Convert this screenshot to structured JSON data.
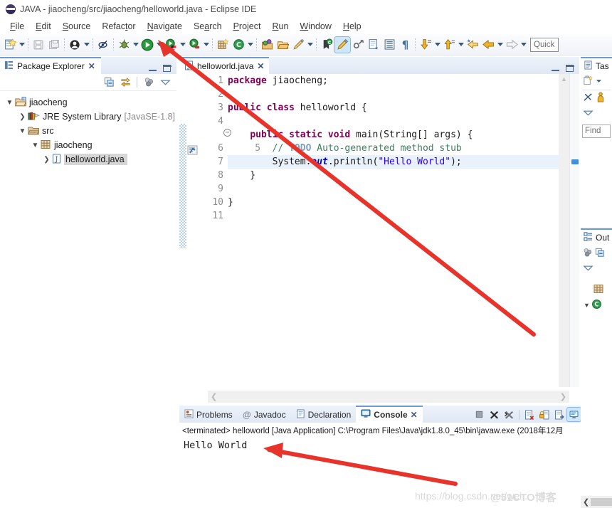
{
  "window": {
    "title": "JAVA - jiaocheng/src/jiaocheng/helloworld.java - Eclipse IDE",
    "logo_icon": "eclipse-logo-icon"
  },
  "menubar": {
    "items": [
      {
        "label": "File",
        "mnemonic": "F"
      },
      {
        "label": "Edit",
        "mnemonic": "E"
      },
      {
        "label": "Source",
        "mnemonic": "S"
      },
      {
        "label": "Refactor",
        "mnemonic": "t"
      },
      {
        "label": "Navigate",
        "mnemonic": "N"
      },
      {
        "label": "Search",
        "mnemonic": "a"
      },
      {
        "label": "Project",
        "mnemonic": "P"
      },
      {
        "label": "Run",
        "mnemonic": "R"
      },
      {
        "label": "Window",
        "mnemonic": "W"
      },
      {
        "label": "Help",
        "mnemonic": "H"
      }
    ]
  },
  "toolbar": {
    "quick_access_placeholder": "Quick Access",
    "buttons": [
      {
        "name": "new-wizard-icon",
        "tooltip": "New"
      },
      {
        "name": "save-icon",
        "tooltip": "Save"
      },
      {
        "name": "save-all-icon",
        "tooltip": "Save All"
      },
      {
        "name": "person-icon",
        "tooltip": "Open Task"
      },
      {
        "name": "skip-breakpoints-icon",
        "tooltip": "Skip All Breakpoints"
      },
      {
        "name": "debug-icon",
        "tooltip": "Debug"
      },
      {
        "name": "run-icon",
        "tooltip": "Run"
      },
      {
        "name": "run-external-tools-icon",
        "tooltip": "External Tools"
      },
      {
        "name": "coverage-icon",
        "tooltip": "Coverage"
      },
      {
        "name": "new-java-package-icon",
        "tooltip": "New Java Package"
      },
      {
        "name": "new-class-icon",
        "tooltip": "New Java Class"
      },
      {
        "name": "open-type-icon",
        "tooltip": "Open Type"
      },
      {
        "name": "open-task-icon",
        "tooltip": "Open Task"
      },
      {
        "name": "pencil-icon",
        "tooltip": "Edit"
      },
      {
        "name": "search-type-icon",
        "tooltip": "Search"
      },
      {
        "name": "marker-icon",
        "tooltip": "Toggle Mark Occurrences"
      },
      {
        "name": "link-icon",
        "tooltip": "Link"
      },
      {
        "name": "next-annotation-icon",
        "tooltip": "Next Annotation"
      },
      {
        "name": "outline-icon",
        "tooltip": "Show Whitespace"
      },
      {
        "name": "pilcrow-icon",
        "tooltip": "Show Whitespace Characters"
      },
      {
        "name": "down-arrow-icon",
        "tooltip": "Next Edit Location"
      },
      {
        "name": "up-arrow-icon",
        "tooltip": "Previous Edit Location"
      },
      {
        "name": "back-star-icon",
        "tooltip": "Back to Last Edit"
      },
      {
        "name": "back-icon",
        "tooltip": "Back"
      },
      {
        "name": "forward-icon",
        "tooltip": "Forward"
      }
    ]
  },
  "package_explorer": {
    "tab_label": "Package Explorer",
    "close_icon": "close-icon",
    "minimize_icon": "minimize-icon",
    "maximize_icon": "maximize-icon",
    "toolbar": [
      {
        "name": "collapse-all-icon"
      },
      {
        "name": "link-with-editor-icon"
      },
      {
        "name": "filter-icon"
      },
      {
        "name": "view-menu-icon"
      }
    ],
    "tree": [
      {
        "label": "jiaocheng",
        "icon": "java-project-icon",
        "indent": 0,
        "expanded": true,
        "selected": false,
        "suffix": ""
      },
      {
        "label": "JRE System Library",
        "icon": "library-icon",
        "indent": 1,
        "expanded": false,
        "selected": false,
        "suffix": "[JavaSE-1.8]"
      },
      {
        "label": "src",
        "icon": "source-folder-icon",
        "indent": 1,
        "expanded": true,
        "selected": false,
        "suffix": ""
      },
      {
        "label": "jiaocheng",
        "icon": "package-icon",
        "indent": 2,
        "expanded": true,
        "selected": false,
        "suffix": ""
      },
      {
        "label": "helloworld.java",
        "icon": "java-file-icon",
        "indent": 3,
        "expanded": false,
        "selected": true,
        "suffix": ""
      }
    ]
  },
  "editor": {
    "tab_label": "helloworld.java",
    "tab_icon": "java-file-icon",
    "close_icon": "close-icon",
    "minimize_icon": "minimize-icon",
    "maximize_icon": "maximize-icon",
    "line_numbers": [
      "1",
      "2",
      "3",
      "4",
      "5",
      "6",
      "7",
      "8",
      "9",
      "10",
      "11"
    ],
    "fold_line": "5",
    "todo_marker_line": "6",
    "highlighted_line": "7",
    "lines": [
      {
        "n": "1",
        "text": "package jiaocheng;"
      },
      {
        "n": "2",
        "text": ""
      },
      {
        "n": "3",
        "text": "public class helloworld {"
      },
      {
        "n": "4",
        "text": ""
      },
      {
        "n": "5",
        "text": "    public static void main(String[] args) {"
      },
      {
        "n": "6",
        "text": "        // TODO Auto-generated method stub"
      },
      {
        "n": "7",
        "text": "        System.out.println(\"Hello World\");"
      },
      {
        "n": "8",
        "text": "    }"
      },
      {
        "n": "9",
        "text": ""
      },
      {
        "n": "10",
        "text": "}"
      },
      {
        "n": "11",
        "text": ""
      }
    ],
    "scroll_left_icon": "chevron-left-icon",
    "scroll_right_icon": "chevron-right-icon"
  },
  "console_panel": {
    "tabs": [
      {
        "label": "Problems",
        "icon": "problems-icon",
        "active": false
      },
      {
        "label": "Javadoc",
        "icon": "javadoc-icon",
        "active": false
      },
      {
        "label": "Declaration",
        "icon": "declaration-icon",
        "active": false
      },
      {
        "label": "Console",
        "icon": "console-icon",
        "active": true
      }
    ],
    "close_icon": "close-icon",
    "toolbar": [
      {
        "name": "terminate-icon",
        "selected": false
      },
      {
        "name": "remove-launch-icon",
        "selected": false
      },
      {
        "name": "remove-all-terminated-icon",
        "selected": false
      },
      {
        "name": "clear-console-icon",
        "selected": false
      },
      {
        "name": "scroll-lock-icon",
        "selected": false
      },
      {
        "name": "pin-console-icon",
        "selected": false
      },
      {
        "name": "display-selected-console-icon",
        "selected": true
      },
      {
        "name": "open-console-icon",
        "selected": true
      },
      {
        "name": "minimize-icon",
        "selected": false
      }
    ],
    "terminated_line": "<terminated> helloworld [Java Application] C:\\Program Files\\Java\\jdk1.8.0_45\\bin\\javaw.exe (2018年12月",
    "output": "Hello World"
  },
  "task_list": {
    "tab_label": "Tas",
    "tab_icon": "task-list-icon",
    "toolbar": [
      {
        "name": "new-task-icon"
      },
      {
        "name": "task-menu-caret-icon"
      },
      {
        "name": "focus-on-workweek-icon"
      },
      {
        "name": "person-task-icon"
      },
      {
        "name": "view-menu-icon"
      }
    ],
    "find_placeholder": "Find"
  },
  "outline": {
    "tab_label": "Out",
    "tab_icon": "outline-icon",
    "toolbar": [
      {
        "name": "filter-icon"
      },
      {
        "name": "collapse-all-icon"
      },
      {
        "name": "view-menu-icon"
      }
    ],
    "items": [
      {
        "label": "",
        "icon": "package-icon",
        "indent": 1,
        "expanded": false
      },
      {
        "label": "",
        "icon": "class-icon",
        "indent": 0,
        "expanded": true
      }
    ],
    "scroll_left_icon": "chevron-left-icon"
  },
  "annotations": {
    "arrow_color": "#e8332a",
    "arrows": [
      {
        "name": "arrow-to-run-button"
      },
      {
        "name": "arrow-to-console-output"
      }
    ]
  },
  "watermarks": [
    {
      "text": "https://blog.csdn.net/wei..."
    },
    {
      "text": "@51CTO博客"
    }
  ],
  "colors": {
    "keyword": "#7f0055",
    "string": "#2a00ff",
    "comment": "#3f7f5f",
    "todo": "#7f9fbf",
    "static_field": "#0000c0",
    "accent": "#6a9cd1",
    "selection": "#d6d6d6",
    "line_highlight": "#e9f1fb"
  }
}
